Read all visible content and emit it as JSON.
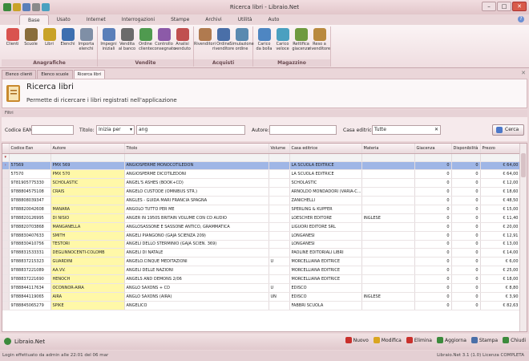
{
  "window": {
    "title": "Ricerca libri - Libraio.Net"
  },
  "tabs": [
    "Base",
    "Usato",
    "Internet",
    "Interrogazioni",
    "Stampe",
    "Archivi",
    "Utilità",
    "Auto"
  ],
  "ribbon": {
    "groups": [
      {
        "label": "Anagrafiche",
        "buttons": [
          {
            "label": "Clienti",
            "color": "#d9534f"
          },
          {
            "label": "Scuole",
            "color": "#8a6d3b"
          },
          {
            "label": "Libri",
            "color": "#c9a227"
          },
          {
            "label": "Elenchi",
            "color": "#3e6fb0"
          },
          {
            "label": "Importa elenchi",
            "color": "#7f8fa6"
          }
        ]
      },
      {
        "label": "Vendite",
        "buttons": [
          {
            "label": "Impegni iniziali",
            "color": "#5b7fb9"
          },
          {
            "label": "Vendita al banco",
            "color": "#6b6b6b"
          },
          {
            "label": "Ordine cliente",
            "color": "#4f9a4f"
          },
          {
            "label": "Controllo consegnato",
            "color": "#8c5aa8"
          },
          {
            "label": "Analisi venduto",
            "color": "#c04f4f"
          }
        ]
      },
      {
        "label": "Acquisti",
        "buttons": [
          {
            "label": "Rivenditori",
            "color": "#b07a4f"
          },
          {
            "label": "Ordine rivenditore",
            "color": "#4a6fa8"
          },
          {
            "label": "Simulazione ordine",
            "color": "#5a8ab0"
          }
        ]
      },
      {
        "label": "Magazzino",
        "buttons": [
          {
            "label": "Carico da bolla",
            "color": "#4e86c2"
          },
          {
            "label": "Carico veloce",
            "color": "#4aa0c0"
          },
          {
            "label": "Rettifica giacenza",
            "color": "#6f9a3f"
          },
          {
            "label": "Reso a rivenditore",
            "color": "#b98a3f"
          }
        ]
      }
    ]
  },
  "doc_tabs": [
    "Elenco clienti",
    "Elenco scuole",
    "Ricerca libri"
  ],
  "header": {
    "title": "Ricerca libri",
    "subtitle": "Permette di ricercare i libri registrati nell'applicazione"
  },
  "filters": {
    "bar_label": "Filtri",
    "ean_label": "Codice EAN:",
    "ean_value": "",
    "title_label": "Titolo:",
    "title_mode": "Inizia per",
    "title_value": "ang",
    "author_label": "Autore:",
    "author_value": "",
    "publisher_label": "Casa editrice:",
    "publisher_value": "Tutte",
    "search_label": "Cerca"
  },
  "grid": {
    "columns": [
      "Codice Ean",
      "Autore",
      "Titolo",
      "Volume",
      "Casa editrice",
      "Materia",
      "Giacenza",
      "Disponibilità",
      "Prezzo"
    ],
    "rows": [
      [
        "57569",
        "PMX 569",
        "ANGIOSPERME MONOCOTILEDON",
        "",
        "LA SCUOLA EDITRICE",
        "",
        "0",
        "0",
        "€ 64,00"
      ],
      [
        "57570",
        "PMX 570",
        "ANGIOSPERME DICOTILEDONI",
        "",
        "LA SCUOLA EDITRICE",
        "",
        "0",
        "0",
        "€ 64,00"
      ],
      [
        "9781905775330",
        "SCHOLASTIC",
        "ANGEL'S ASHES (BOOK+CD)",
        "",
        "SCHOLASTIC",
        "",
        "0",
        "0",
        "€ 12,00"
      ],
      [
        "9788804575108",
        "CRAIS",
        "ANGELO CUSTODE (OMNIBUS STR.)",
        "",
        "ARNOLDO MONDADORI (VARIA-C...",
        "",
        "0",
        "0",
        "€ 18,60"
      ],
      [
        "9788808039347",
        "",
        "ANGLES - GUIDA MARI FRANCIA SPAGNA",
        "",
        "ZANICHELLI",
        "",
        "0",
        "0",
        "€ 48,50"
      ],
      [
        "9788820042608",
        "MANARA",
        "ANGOLO TUTTO PER ME",
        "",
        "SPERLING & KUPFER",
        "",
        "0",
        "0",
        "€ 15,00"
      ],
      [
        "9788820126995",
        "DI NISIO",
        "ANGER IN 1950S BRITAIN VOLUME CON CD AUDIO",
        "",
        "LOESCHER EDITORE",
        "INGLESE",
        "0",
        "0",
        "€ 11,40"
      ],
      [
        "9788820703868",
        "MANGANELLA",
        "ANGLOSASSONE E SASSONE ANTICO, GRAMMATICA",
        "",
        "LIGUORI EDITORE SRL",
        "",
        "0",
        "0",
        "€ 20,00"
      ],
      [
        "9788830407633",
        "SMITH",
        "ANGELI PIANGONO (GAJA SCIENZA 209)",
        "",
        "LONGANESI",
        "",
        "0",
        "0",
        "€ 12,91"
      ],
      [
        "9788830410756",
        "TESTORI",
        "ANGELI DELLO STERMINIO (GAJA SCIEN. 369)",
        "",
        "LONGANESI",
        "",
        "0",
        "0",
        "€ 13,00"
      ],
      [
        "9788831533331",
        "DEGLINNOCENTI-COLOMB",
        "ANGELI DI NATALE",
        "",
        "PAOLINE EDITORIALI LIBRI",
        "",
        "0",
        "0",
        "€ 14,00"
      ],
      [
        "9788837215323",
        "GUARDINI",
        "ANGELO.CINQUE MEDITAZIONI",
        "U",
        "MORCELLIANA EDITRICE",
        "",
        "0",
        "0",
        "€ 6,00"
      ],
      [
        "9788837221089",
        "AA.VV.",
        "ANGELI DELLE NAZIONI",
        "",
        "MORCELLIANA EDITRICE",
        "",
        "0",
        "0",
        "€ 25,00"
      ],
      [
        "9788837221690",
        "HENOCH",
        "ANGELS AND DEMONS 2/06",
        "",
        "MORCELLIANA EDITRICE",
        "",
        "0",
        "0",
        "€ 18,00"
      ],
      [
        "9788844117634",
        "OCONNOR-AIRA",
        "ANGLO SAXONS + CD",
        "U",
        "EDISCO",
        "",
        "0",
        "0",
        "€ 8,80"
      ],
      [
        "9788844119065",
        "AIRA",
        "ANGLO SAXONS (AIRA)",
        "UN",
        "EDISCO",
        "INGLESE",
        "0",
        "0",
        "€ 3,90"
      ],
      [
        "9788845065279",
        "SPIKE",
        "ANGELICO",
        "",
        "FABBRI SCUOLA",
        "",
        "0",
        "0",
        "€ 82,63"
      ]
    ]
  },
  "bottom": {
    "app_name": "Libraio.Net",
    "actions": [
      {
        "label": "Nuovo",
        "color": "#c9302c"
      },
      {
        "label": "Modifica",
        "color": "#d9a520"
      },
      {
        "label": "Elimina",
        "color": "#c9302c"
      },
      {
        "label": "Aggiorna",
        "color": "#3c8a3c"
      },
      {
        "label": "Stampa",
        "color": "#4a6fa8"
      },
      {
        "label": "Chiudi",
        "color": "#3c8a3c"
      }
    ]
  },
  "status": {
    "left": "Login effettuato da admin alle 22:01 del 06 mar",
    "right": "Libraio.Net 3.1 (1.0) Licenza COMPLETA"
  }
}
